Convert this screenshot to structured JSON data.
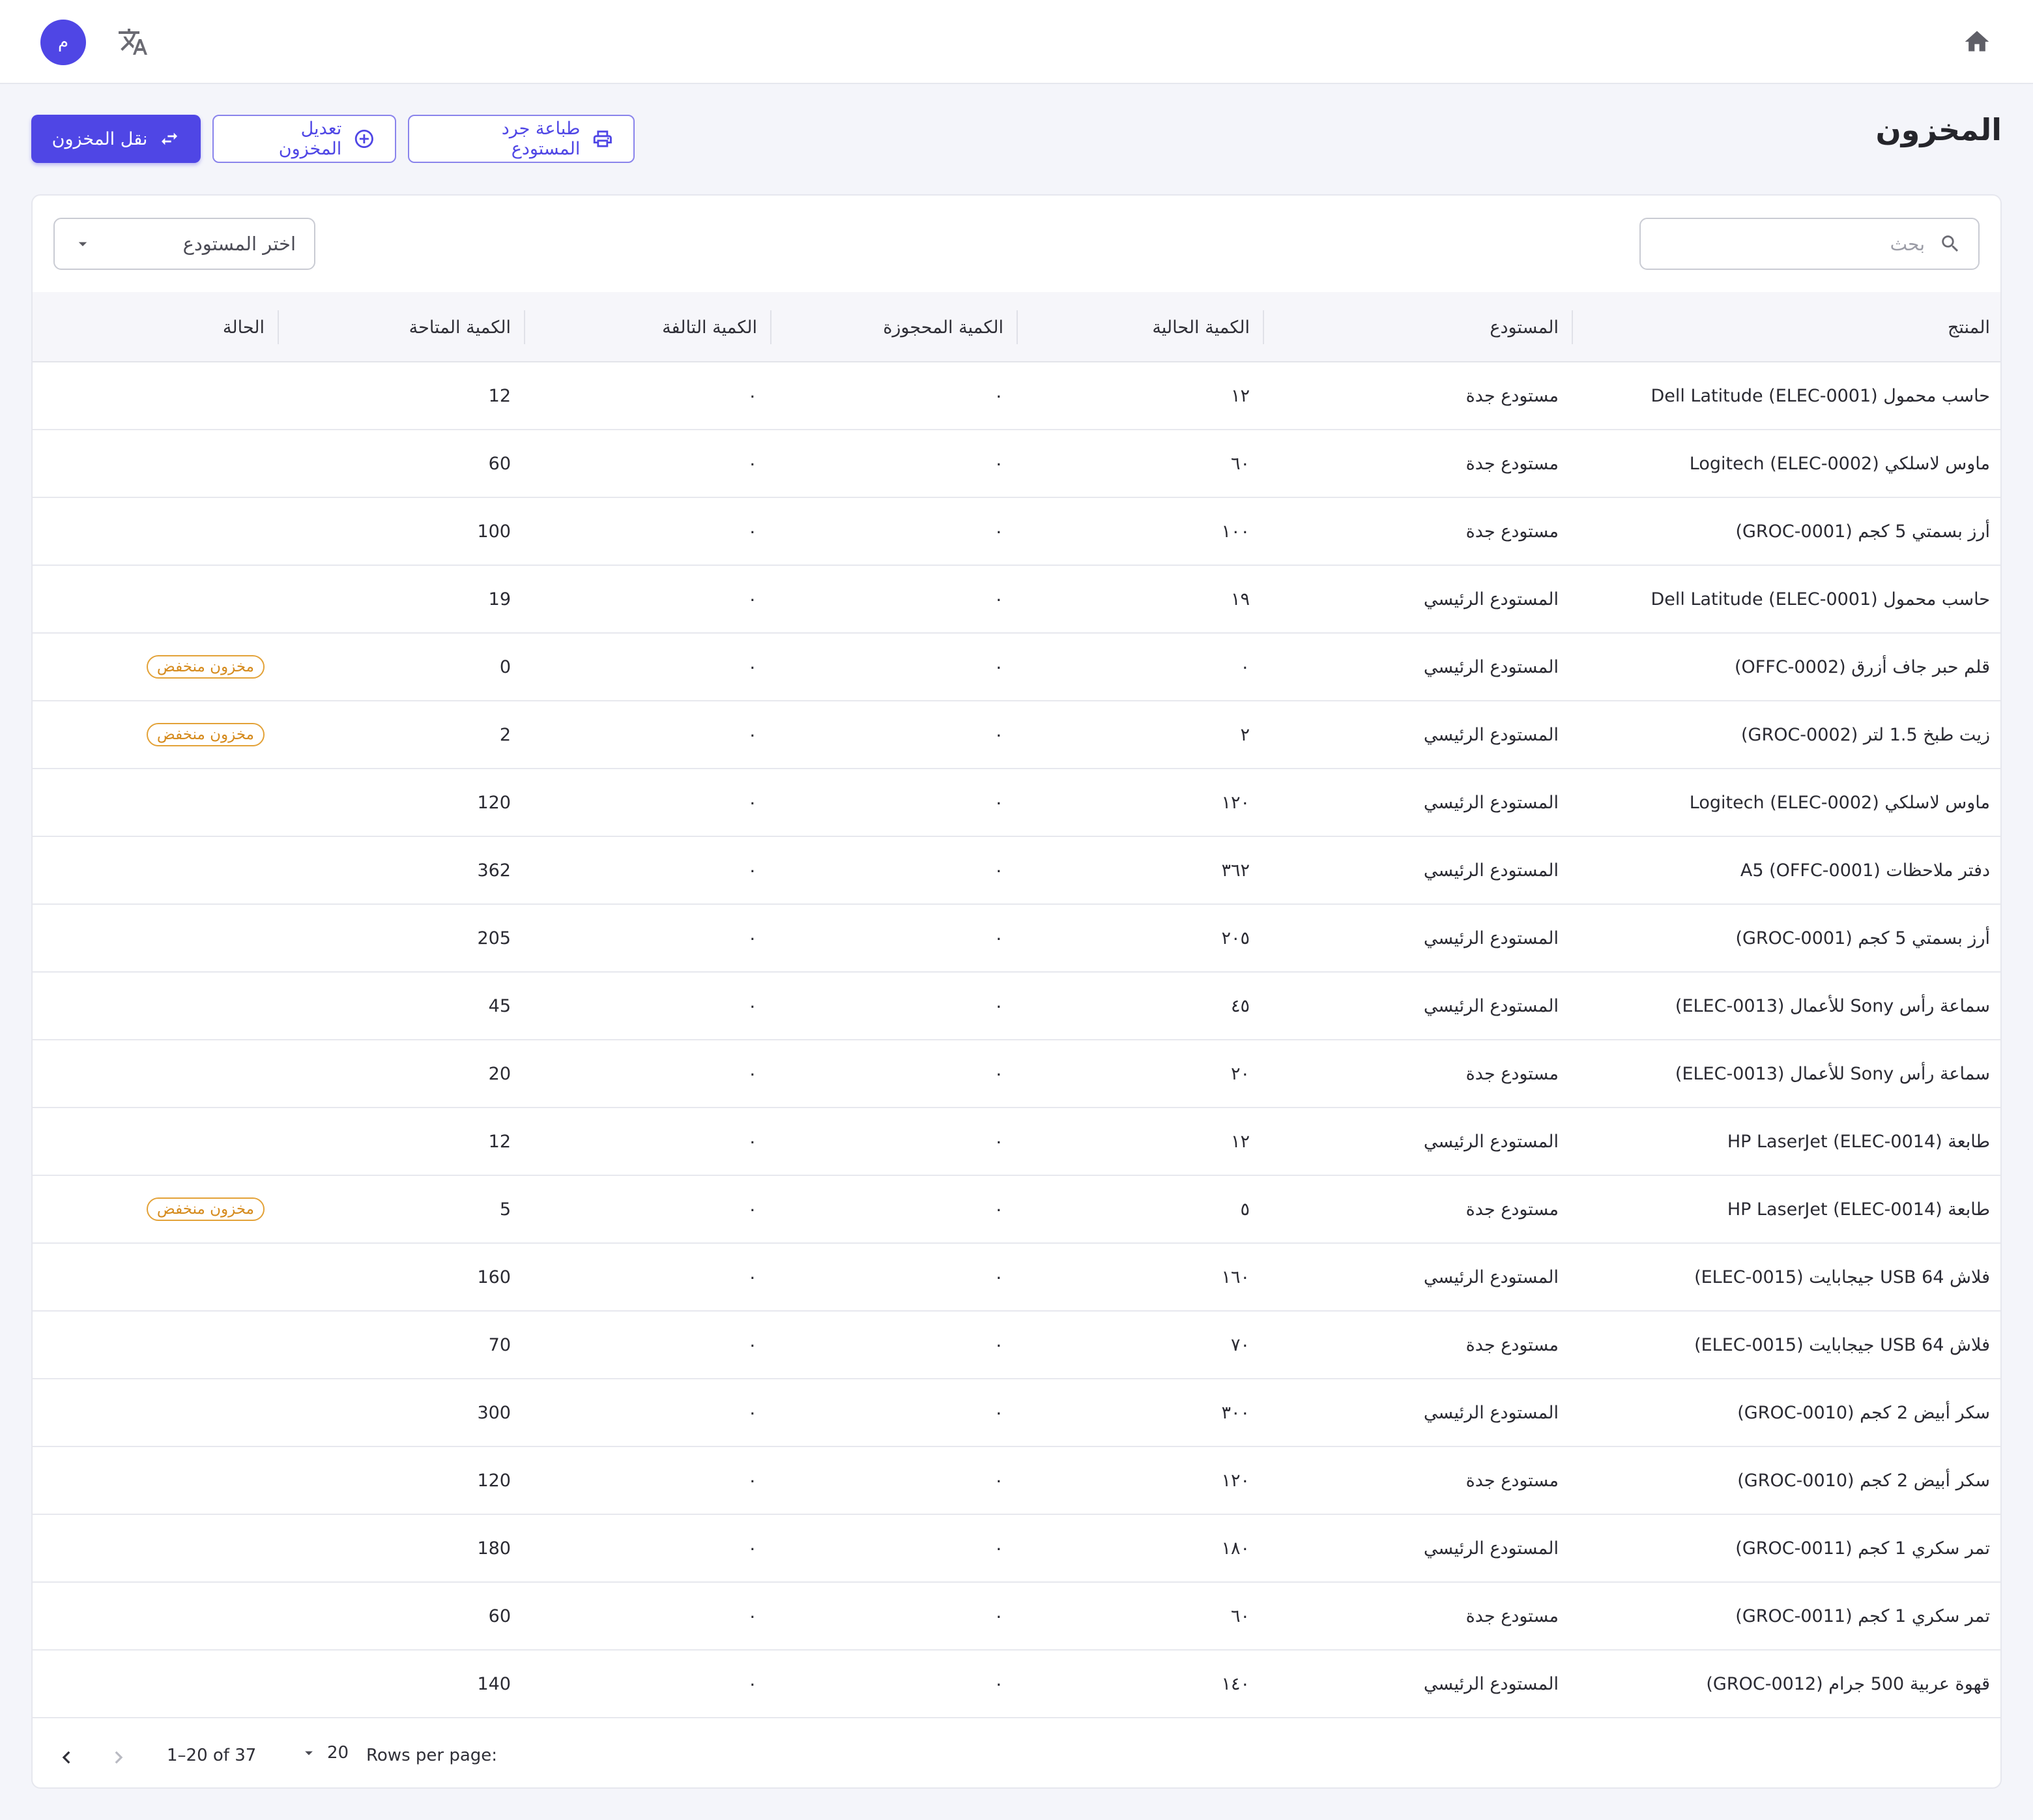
{
  "header": {
    "avatar_initial": "م",
    "icons": [
      "home-icon",
      "translate-icon"
    ]
  },
  "page": {
    "title": "المخزون"
  },
  "actions": {
    "transfer_label": "نقل المخزون",
    "adjust_label": "تعديل المخزون",
    "print_label": "طباعة جرد المستودع",
    "primary_color": "#4f46e5"
  },
  "filters": {
    "search_placeholder": "بحث",
    "warehouse_placeholder": "اختر المستودع"
  },
  "table": {
    "columns": [
      "المنتج",
      "المستودع",
      "الكمية الحالية",
      "الكمية المحجوزة",
      "الكمية التالفة",
      "الكمية المتاحة",
      "الحالة"
    ],
    "rows": [
      {
        "product": "حاسب محمول Dell Latitude (ELEC-0001)",
        "warehouse": "مستودع جدة",
        "current": "١٢",
        "reserved": "٠",
        "damaged": "٠",
        "available": "12",
        "status": ""
      },
      {
        "product": "ماوس لاسلكي Logitech (ELEC-0002)",
        "warehouse": "مستودع جدة",
        "current": "٦٠",
        "reserved": "٠",
        "damaged": "٠",
        "available": "60",
        "status": ""
      },
      {
        "product": "أرز بسمتي 5 كجم (GROC-0001)",
        "warehouse": "مستودع جدة",
        "current": "١٠٠",
        "reserved": "٠",
        "damaged": "٠",
        "available": "100",
        "status": ""
      },
      {
        "product": "حاسب محمول Dell Latitude (ELEC-0001)",
        "warehouse": "المستودع الرئيسي",
        "current": "١٩",
        "reserved": "٠",
        "damaged": "٠",
        "available": "19",
        "status": ""
      },
      {
        "product": "قلم حبر جاف أزرق (OFFC-0002)",
        "warehouse": "المستودع الرئيسي",
        "current": "٠",
        "reserved": "٠",
        "damaged": "٠",
        "available": "0",
        "status": "مخزون منخفض"
      },
      {
        "product": "زيت طبخ 1.5 لتر (GROC-0002)",
        "warehouse": "المستودع الرئيسي",
        "current": "٢",
        "reserved": "٠",
        "damaged": "٠",
        "available": "2",
        "status": "مخزون منخفض"
      },
      {
        "product": "ماوس لاسلكي Logitech (ELEC-0002)",
        "warehouse": "المستودع الرئيسي",
        "current": "١٢٠",
        "reserved": "٠",
        "damaged": "٠",
        "available": "120",
        "status": ""
      },
      {
        "product": "دفتر ملاحظات A5 (OFFC-0001)",
        "warehouse": "المستودع الرئيسي",
        "current": "٣٦٢",
        "reserved": "٠",
        "damaged": "٠",
        "available": "362",
        "status": ""
      },
      {
        "product": "أرز بسمتي 5 كجم (GROC-0001)",
        "warehouse": "المستودع الرئيسي",
        "current": "٢٠٥",
        "reserved": "٠",
        "damaged": "٠",
        "available": "205",
        "status": ""
      },
      {
        "product": "سماعة رأس Sony للأعمال (ELEC-0013)",
        "warehouse": "المستودع الرئيسي",
        "current": "٤٥",
        "reserved": "٠",
        "damaged": "٠",
        "available": "45",
        "status": ""
      },
      {
        "product": "سماعة رأس Sony للأعمال (ELEC-0013)",
        "warehouse": "مستودع جدة",
        "current": "٢٠",
        "reserved": "٠",
        "damaged": "٠",
        "available": "20",
        "status": ""
      },
      {
        "product": "طابعة HP LaserJet (ELEC-0014)",
        "warehouse": "المستودع الرئيسي",
        "current": "١٢",
        "reserved": "٠",
        "damaged": "٠",
        "available": "12",
        "status": ""
      },
      {
        "product": "طابعة HP LaserJet (ELEC-0014)",
        "warehouse": "مستودع جدة",
        "current": "٥",
        "reserved": "٠",
        "damaged": "٠",
        "available": "5",
        "status": "مخزون منخفض"
      },
      {
        "product": "فلاش USB 64 جيجابايت (ELEC-0015)",
        "warehouse": "المستودع الرئيسي",
        "current": "١٦٠",
        "reserved": "٠",
        "damaged": "٠",
        "available": "160",
        "status": ""
      },
      {
        "product": "فلاش USB 64 جيجابايت (ELEC-0015)",
        "warehouse": "مستودع جدة",
        "current": "٧٠",
        "reserved": "٠",
        "damaged": "٠",
        "available": "70",
        "status": ""
      },
      {
        "product": "سكر أبيض 2 كجم (GROC-0010)",
        "warehouse": "المستودع الرئيسي",
        "current": "٣٠٠",
        "reserved": "٠",
        "damaged": "٠",
        "available": "300",
        "status": ""
      },
      {
        "product": "سكر أبيض 2 كجم (GROC-0010)",
        "warehouse": "مستودع جدة",
        "current": "١٢٠",
        "reserved": "٠",
        "damaged": "٠",
        "available": "120",
        "status": ""
      },
      {
        "product": "تمر سكري 1 كجم (GROC-0011)",
        "warehouse": "المستودع الرئيسي",
        "current": "١٨٠",
        "reserved": "٠",
        "damaged": "٠",
        "available": "180",
        "status": ""
      },
      {
        "product": "تمر سكري 1 كجم (GROC-0011)",
        "warehouse": "مستودع جدة",
        "current": "٦٠",
        "reserved": "٠",
        "damaged": "٠",
        "available": "60",
        "status": ""
      },
      {
        "product": "قهوة عربية 500 جرام (GROC-0012)",
        "warehouse": "المستودع الرئيسي",
        "current": "١٤٠",
        "reserved": "٠",
        "damaged": "٠",
        "available": "140",
        "status": ""
      }
    ]
  },
  "pagination": {
    "rows_per_page_label": "Rows per page:",
    "rows_per_page_value": "20",
    "range_text": "1–20 of 37"
  },
  "colors": {
    "badge": "#d58a1c",
    "accent": "#4f46e5"
  }
}
